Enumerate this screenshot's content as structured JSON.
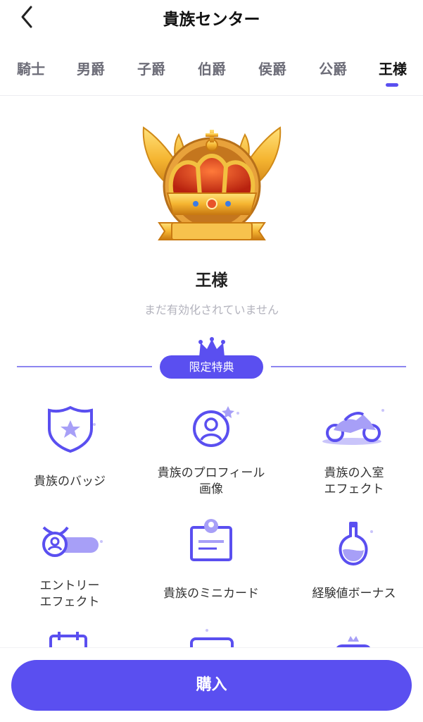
{
  "header": {
    "title": "貴族センター"
  },
  "tabs": [
    {
      "label": "騎士"
    },
    {
      "label": "男爵"
    },
    {
      "label": "子爵"
    },
    {
      "label": "伯爵"
    },
    {
      "label": "侯爵"
    },
    {
      "label": "公爵"
    },
    {
      "label": "王様",
      "active": true
    }
  ],
  "rank": {
    "name": "王様",
    "status": "まだ有効化されていません"
  },
  "section": {
    "title": "限定特典"
  },
  "benefits": [
    {
      "label": "貴族のバッジ",
      "icon": "badge-icon"
    },
    {
      "label": "貴族のプロフィール\n画像",
      "icon": "profile-avatar-icon"
    },
    {
      "label": "貴族の入室\nエフェクト",
      "icon": "motorcycle-icon"
    },
    {
      "label": "エントリー\nエフェクト",
      "icon": "winged-entry-icon"
    },
    {
      "label": "貴族のミニカード",
      "icon": "mini-card-icon"
    },
    {
      "label": "経験値ボーナス",
      "icon": "potion-icon"
    }
  ],
  "footer": {
    "buy_label": "購入"
  },
  "colors": {
    "accent": "#5a4ff0",
    "accent_light": "#a79ff7"
  }
}
